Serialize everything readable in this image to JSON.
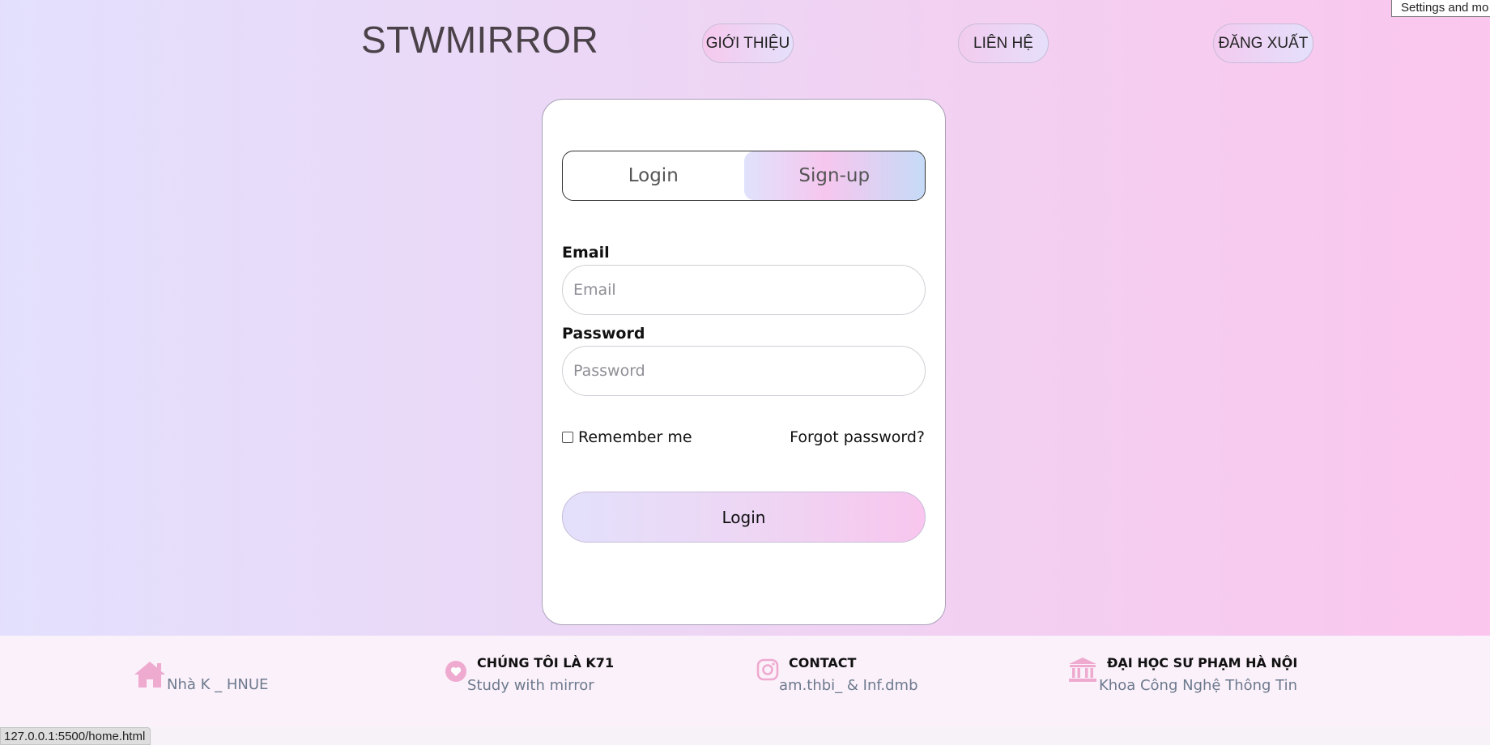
{
  "header": {
    "brand": "STWMIRROR",
    "nav": {
      "about": "GIỚI THIỆU",
      "contact": "LIÊN HỆ",
      "logout": "ĐĂNG XUẤT"
    }
  },
  "tooltip": "Settings and mo",
  "auth": {
    "tabs": {
      "login": "Login",
      "signup": "Sign-up"
    },
    "email": {
      "label": "Email",
      "placeholder": "Email",
      "value": ""
    },
    "password": {
      "label": "Password",
      "placeholder": "Password",
      "value": ""
    },
    "remember_label": "Remember me",
    "forgot_label": "Forgot password?",
    "submit_label": "Login"
  },
  "footer": {
    "home": {
      "icon": "home-icon",
      "text": "Nhà K _ HNUE"
    },
    "about": {
      "icon": "heart-icon",
      "title": "CHÚNG TÔI LÀ K71",
      "text": "Study with mirror"
    },
    "contact": {
      "icon": "instagram-icon",
      "title": "CONTACT",
      "text": "am.thbi_ & Inf.dmb"
    },
    "university": {
      "icon": "university-icon",
      "title": "ĐẠI HỌC SƯ PHẠM HÀ NỘI",
      "text": "Khoa Công Nghệ Thông Tin"
    }
  },
  "status_url": "127.0.0.1:5500/home.html",
  "colors": {
    "accent_pink": "#f6c8ee",
    "accent_lavender": "#e3e0fd",
    "footer_icon": "#eeaacf"
  }
}
